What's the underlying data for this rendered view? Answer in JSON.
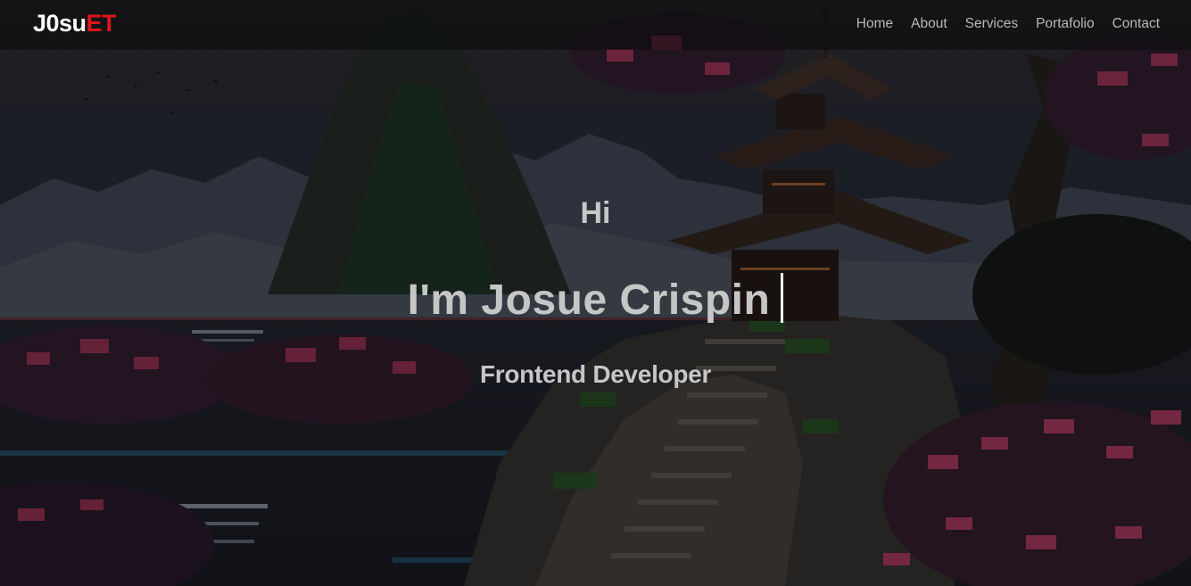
{
  "nav": {
    "brand_part1": "J0su",
    "brand_part2": "ET",
    "links": [
      "Home",
      "About",
      "Services",
      "Portafolio",
      "Contact"
    ]
  },
  "hero": {
    "greeting": "Hi",
    "name": "I'm Josue Crispin",
    "role": "Frontend Developer"
  },
  "colors": {
    "brand_accent": "#e1141c",
    "nav_text": "#b9b9b9",
    "hero_text": "#c6c6c6"
  }
}
